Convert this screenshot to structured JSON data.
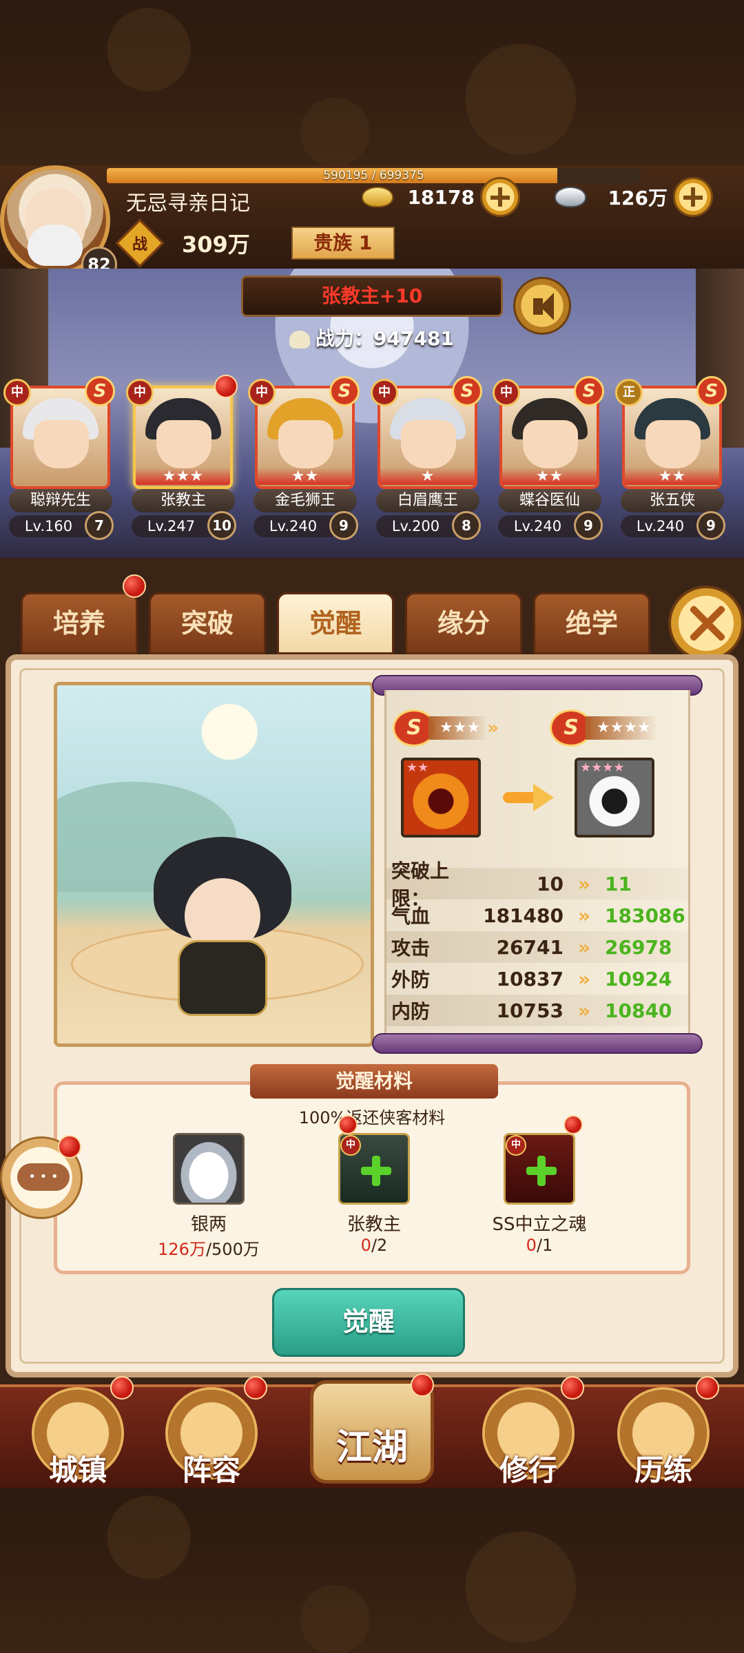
{
  "player": {
    "name": "无忌寻亲日记",
    "level": "82",
    "exp_text": "590195 / 699375",
    "exp_fraction": 0.844,
    "gold": "18178",
    "silver": "126万",
    "battle_icon": "战",
    "battle_power": "309万",
    "noble": "贵族 1"
  },
  "scene": {
    "leader_label": "张教主+10",
    "combat_power_label": "战力：",
    "combat_power_value": "947481"
  },
  "heroes": [
    {
      "name": "聪辩先生",
      "level": "Lv.160",
      "break": "7",
      "faction": "中",
      "stars": "",
      "grade": "S",
      "hair": "#e8e8ea"
    },
    {
      "name": "张教主",
      "level": "Lv.247",
      "break": "10",
      "faction": "中",
      "stars": "★★★",
      "grade": "",
      "hair": "#2a2a30",
      "selected": true
    },
    {
      "name": "金毛狮王",
      "level": "Lv.240",
      "break": "9",
      "faction": "中",
      "stars": "★★",
      "grade": "S",
      "hair": "#e2a22a"
    },
    {
      "name": "白眉鹰王",
      "level": "Lv.200",
      "break": "8",
      "faction": "中",
      "stars": "★",
      "grade": "S",
      "hair": "#d8dde6"
    },
    {
      "name": "蝶谷医仙",
      "level": "Lv.240",
      "break": "9",
      "faction": "中",
      "stars": "★★",
      "grade": "S",
      "hair": "#2f2a26"
    },
    {
      "name": "张五侠",
      "level": "Lv.240",
      "break": "9",
      "faction": "正",
      "stars": "★★",
      "grade": "S",
      "hair": "#2a3a40"
    }
  ],
  "tabs": [
    "培养",
    "突破",
    "觉醒",
    "缘分",
    "绝学"
  ],
  "active_tab": "觉醒",
  "awaken": {
    "grade_from": "S",
    "stars_from": "★★★",
    "grade_to": "S",
    "stars_to": "★★★★",
    "skill_stars_from": "★★",
    "skill_stars_to": "★★★★",
    "chevron": "»",
    "stats": [
      {
        "label": "突破上限：",
        "current": "10",
        "next": "11"
      },
      {
        "label": "气血",
        "current": "181480",
        "next": "183086"
      },
      {
        "label": "攻击",
        "current": "26741",
        "next": "26978"
      },
      {
        "label": "外防",
        "current": "10837",
        "next": "10924"
      },
      {
        "label": "内防",
        "current": "10753",
        "next": "10840"
      }
    ]
  },
  "materials": {
    "title": "觉醒材料",
    "subtitle": "100%返还侠客材料",
    "items": [
      {
        "name": "银两",
        "have": "126万",
        "need": "/500万"
      },
      {
        "name": "张教主",
        "have": "0",
        "need": "/2"
      },
      {
        "name": "SS中立之魂",
        "have": "0",
        "need": "/1"
      }
    ],
    "hero_faction": "中",
    "soul_faction": "中"
  },
  "awaken_button": "觉醒",
  "nav": [
    "城镇",
    "阵容",
    "江湖",
    "修行",
    "历练"
  ],
  "colors": {
    "accent_gold": "#f2b24a",
    "stat_up_green": "#4ab41e",
    "alert_red": "#d02a1a",
    "awaken_teal": "#2a9e86"
  }
}
